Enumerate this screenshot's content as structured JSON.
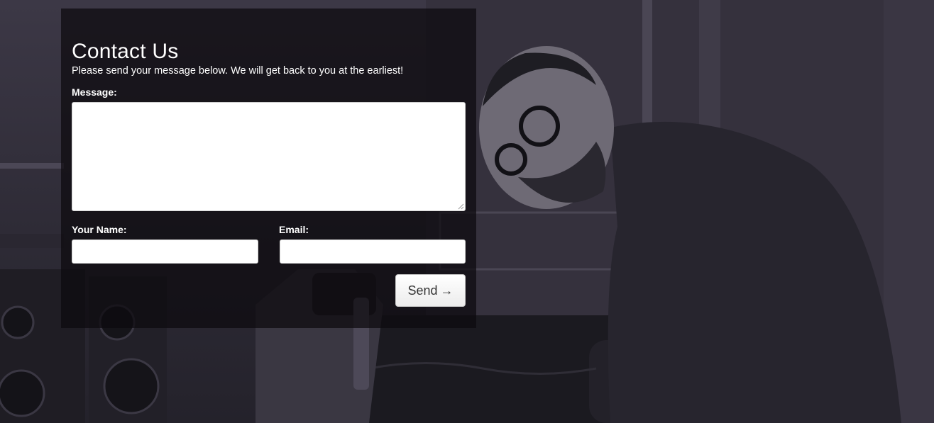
{
  "contact_form": {
    "title": "Contact Us",
    "subtitle": "Please send your message below. We will get back to you at the earliest!",
    "message_label": "Message:",
    "message_value": "",
    "name_label": "Your Name:",
    "name_value": "",
    "email_label": "Email:",
    "email_value": "",
    "send_label": "Send",
    "send_arrow": "→"
  },
  "colors": {
    "panel_overlay": "#0c0a0e",
    "text": "#ffffff",
    "button_text": "#333333",
    "background_tint": "#3c3846"
  },
  "icons": {
    "send_arrow": "right-arrow-icon"
  }
}
